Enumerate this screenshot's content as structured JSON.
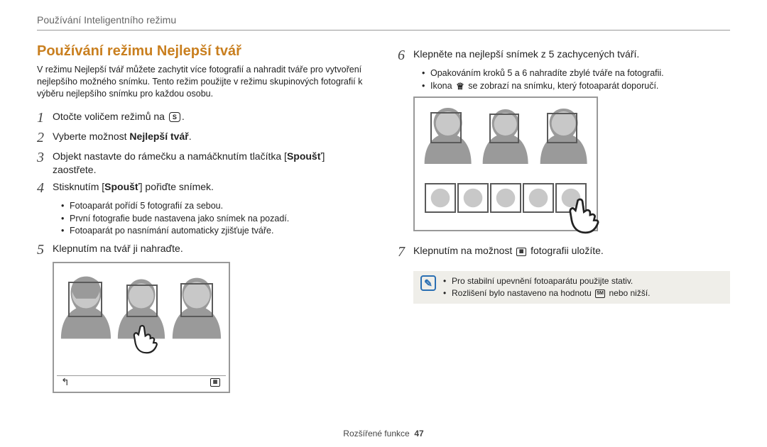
{
  "breadcrumb": "Používání Inteligentního režimu",
  "section_title": "Používání režimu Nejlepší tvář",
  "intro": "V režimu Nejlepší tvář můžete zachytit více fotografií a nahradit tváře pro vytvoření nejlepšího možného snímku. Tento režim použijte v režimu skupinových fotografií k výběru nejlepšího snímku pro každou osobu.",
  "steps": {
    "s1": {
      "num": "1",
      "text_pre": "Otočte voličem režimů na ",
      "icon_label": "S",
      "text_post": "."
    },
    "s2": {
      "num": "2",
      "text_pre": "Vyberte možnost ",
      "bold": "Nejlepší tvář",
      "text_post": "."
    },
    "s3": {
      "num": "3",
      "text_pre": "Objekt nastavte do rámečku a namáčknutím tlačítka [",
      "bold": "Spoušť",
      "text_post": "] zaostřete."
    },
    "s4": {
      "num": "4",
      "text_pre": "Stisknutím [",
      "bold": "Spoušť",
      "text_post": "] pořiďte snímek.",
      "bullets": [
        "Fotoaparát pořídí 5 fotografií za sebou.",
        "První fotografie bude nastavena jako snímek na pozadí.",
        "Fotoaparát po nasnímání automaticky zjišťuje tváře."
      ]
    },
    "s5": {
      "num": "5",
      "text": "Klepnutím na tvář ji nahraďte."
    },
    "s6": {
      "num": "6",
      "text": "Klepněte na nejlepší snímek z 5 zachycených tváří.",
      "bullets": [
        "Opakováním kroků 5 a 6 nahradíte zbylé tváře na fotografii."
      ],
      "bullet2_pre": "Ikona ",
      "bullet2_post": " se zobrazí na snímku, který fotoaparát doporučí."
    },
    "s7": {
      "num": "7",
      "text_pre": "Klepnutím na možnost ",
      "text_post": " fotografii uložíte."
    }
  },
  "notebox": {
    "line1": "Pro stabilní upevnění fotoaparátu použijte stativ.",
    "line2_pre": "Rozlišení bylo nastaveno na hodnotu ",
    "line2_label": "5M",
    "line2_post": " nebo nižší."
  },
  "footer": {
    "label": "Rozšířené funkce",
    "page": "47"
  }
}
